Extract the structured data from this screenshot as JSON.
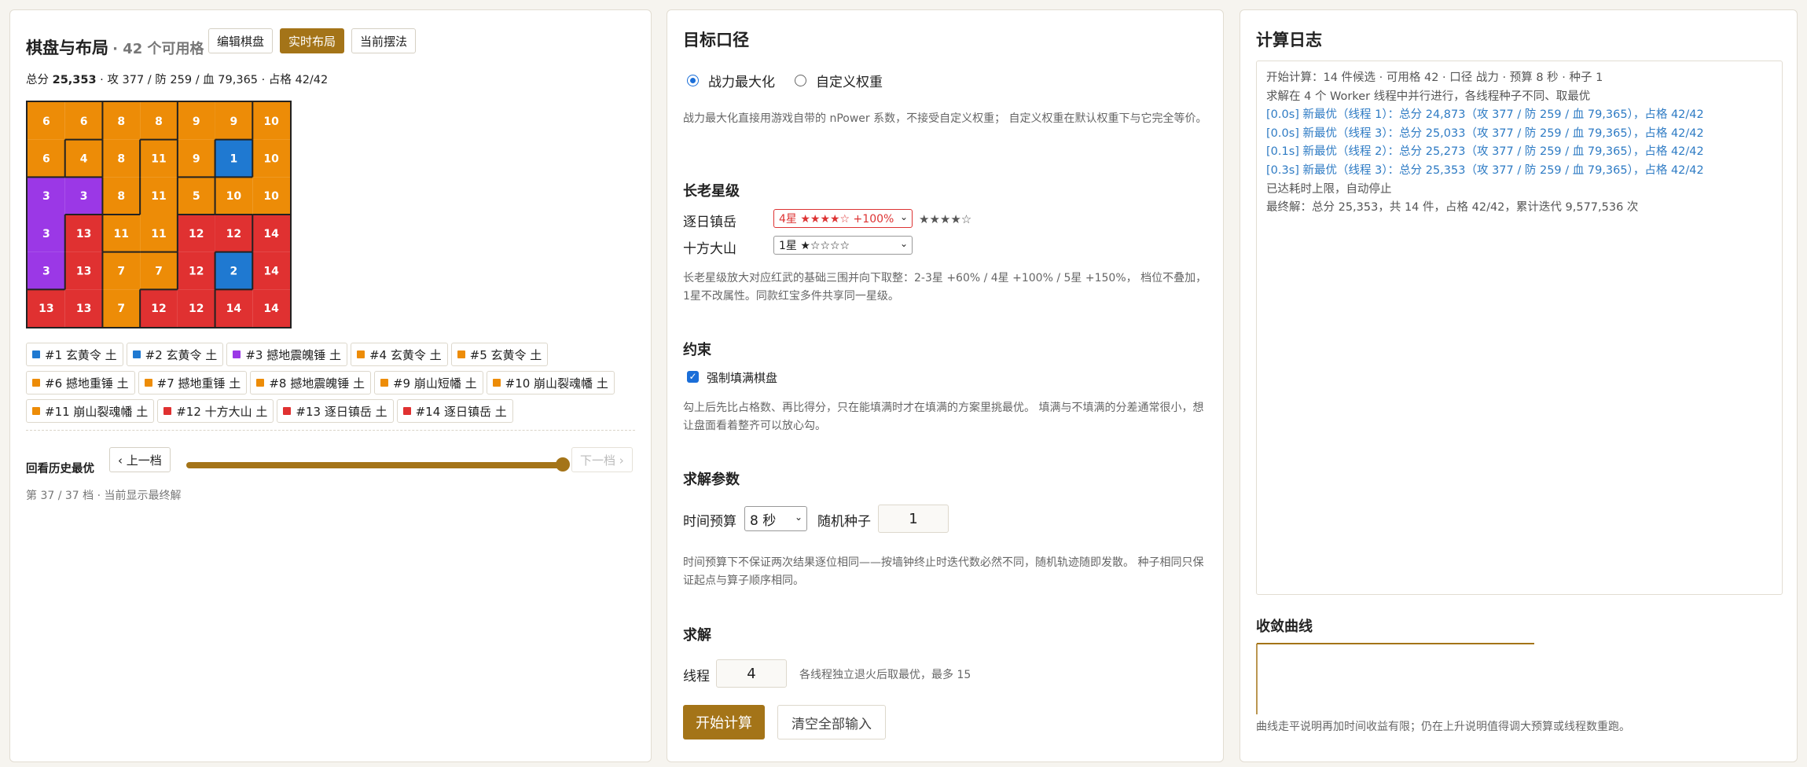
{
  "layout_panel": {
    "title": "棋盘与布局",
    "subtitle": "· 42 个可用格",
    "tabs": [
      "编辑棋盘",
      "实时布局",
      "当前摆法"
    ],
    "summary_prefix": "总分 ",
    "summary_score": "25,353",
    "summary_rest": " · 攻 377 / 防 259 / 血 79,365 · 占格 42/42",
    "board_rows": [
      [
        6,
        6,
        8,
        8,
        9,
        9,
        10
      ],
      [
        6,
        4,
        8,
        11,
        9,
        1,
        10
      ],
      [
        3,
        3,
        8,
        11,
        5,
        10,
        10
      ],
      [
        3,
        13,
        11,
        11,
        12,
        12,
        14
      ],
      [
        3,
        13,
        7,
        7,
        12,
        2,
        14
      ],
      [
        13,
        13,
        7,
        12,
        12,
        14,
        14
      ]
    ],
    "piece_colors": {
      "1": "#1f79d1",
      "2": "#1f79d1",
      "3": "#9b38e6",
      "4": "#ed8c07",
      "5": "#ed8c07",
      "6": "#ed8c07",
      "7": "#ed8c07",
      "8": "#ed8c07",
      "9": "#ed8c07",
      "10": "#ed8c07",
      "11": "#ed8c07",
      "12": "#e03131",
      "13": "#e03131",
      "14": "#e03131"
    },
    "pieces": [
      {
        "label": "#1 玄黄令 土",
        "color": "#1f79d1"
      },
      {
        "label": "#2 玄黄令 土",
        "color": "#1f79d1"
      },
      {
        "label": "#3 撼地震魄锤 土",
        "color": "#9b38e6"
      },
      {
        "label": "#4 玄黄令 土",
        "color": "#ed8c07"
      },
      {
        "label": "#5 玄黄令 土",
        "color": "#ed8c07"
      },
      {
        "label": "#6 撼地重锤 土",
        "color": "#ed8c07"
      },
      {
        "label": "#7 撼地重锤 土",
        "color": "#ed8c07"
      },
      {
        "label": "#8 撼地震魄锤 土",
        "color": "#ed8c07"
      },
      {
        "label": "#9 崩山短幡 土",
        "color": "#ed8c07"
      },
      {
        "label": "#10 崩山裂魂幡 土",
        "color": "#ed8c07"
      },
      {
        "label": "#11 崩山裂魂幡 土",
        "color": "#ed8c07"
      },
      {
        "label": "#12 十方大山 土",
        "color": "#e03131"
      },
      {
        "label": "#13 逐日镇岳 土",
        "color": "#e03131"
      },
      {
        "label": "#14 逐日镇岳 土",
        "color": "#e03131"
      }
    ],
    "history_label": "回看历史最优",
    "prev_label": "‹ 上一档",
    "next_label": "下一档 ›",
    "history_progress": 1.0,
    "history_status": "第 37 / 37 档 · 当前显示最终解"
  },
  "target_panel": {
    "title": "目标口径",
    "options": [
      "战力最大化",
      "自定义权重"
    ],
    "selected_option": "战力最大化",
    "desc1": "战力最大化直接用游戏自带的 nPower 系数，不接受自定义权重； 自定义权重在默认权重下与它完全等价。",
    "elder_title": "长老星级",
    "elders": [
      {
        "name": "逐日镇岳",
        "select": "4星 ★★★★☆ +100%",
        "stars": "★★★★☆",
        "highlight": true
      },
      {
        "name": "十方大山",
        "select": "1星 ★☆☆☆☆",
        "stars": "",
        "highlight": false
      }
    ],
    "elder_desc": "长老星级放大对应红武的基础三围并向下取整：2-3星 +60% / 4星 +100% / 5星 +150%， 档位不叠加，1星不改属性。同款红宝多件共享同一星级。",
    "constraint_title": "约束",
    "constraint_label": "强制填满棋盘",
    "constraint_checked": true,
    "constraint_desc": "勾上后先比占格数、再比得分，只在能填满时才在填满的方案里挑最优。 填满与不填满的分差通常很小，想让盘面看着整齐可以放心勾。",
    "params_title": "求解参数",
    "time_label": "时间预算",
    "time_value": "8 秒",
    "seed_label": "随机种子",
    "seed_value": "1",
    "params_desc": "时间预算下不保证两次结果逐位相同——按墙钟终止时迭代数必然不同，随机轨迹随即发散。 种子相同只保证起点与算子顺序相同。",
    "solve_title": "求解",
    "threads_label": "线程",
    "threads_value": "4",
    "threads_hint": "各线程独立退火后取最优，最多 15",
    "start_label": "开始计算",
    "clear_label": "清空全部输入"
  },
  "log_panel": {
    "title": "计算日志",
    "lines": [
      {
        "text": "开始计算：14 件候选 · 可用格 42 · 口径 战力 · 预算 8 秒 · 种子 1",
        "kind": "normal"
      },
      {
        "text": "求解在 4 个 Worker 线程中并行进行，各线程种子不同、取最优",
        "kind": "normal"
      },
      {
        "text": "[0.0s] 新最优（线程 1）：总分 24,873（攻 377 / 防 259 / 血 79,365），占格 42/42",
        "kind": "blue"
      },
      {
        "text": "[0.0s] 新最优（线程 3）：总分 25,033（攻 377 / 防 259 / 血 79,365），占格 42/42",
        "kind": "blue"
      },
      {
        "text": "[0.1s] 新最优（线程 2）：总分 25,273（攻 377 / 防 259 / 血 79,365），占格 42/42",
        "kind": "blue"
      },
      {
        "text": "[0.3s] 新最优（线程 3）：总分 25,353（攻 377 / 防 259 / 血 79,365），占格 42/42",
        "kind": "blue"
      },
      {
        "text": "已达耗时上限，自动停止",
        "kind": "normal"
      },
      {
        "text": "最终解：总分 25,353，共 14 件，占格 42/42，累计迭代 9,577,536 次",
        "kind": "normal"
      }
    ],
    "curve_title": "收敛曲线",
    "curve_color": "#a47418",
    "curve_note": "曲线走平说明再加时间收益有限；仍在上升说明值得调大预算或线程数重跑。"
  }
}
